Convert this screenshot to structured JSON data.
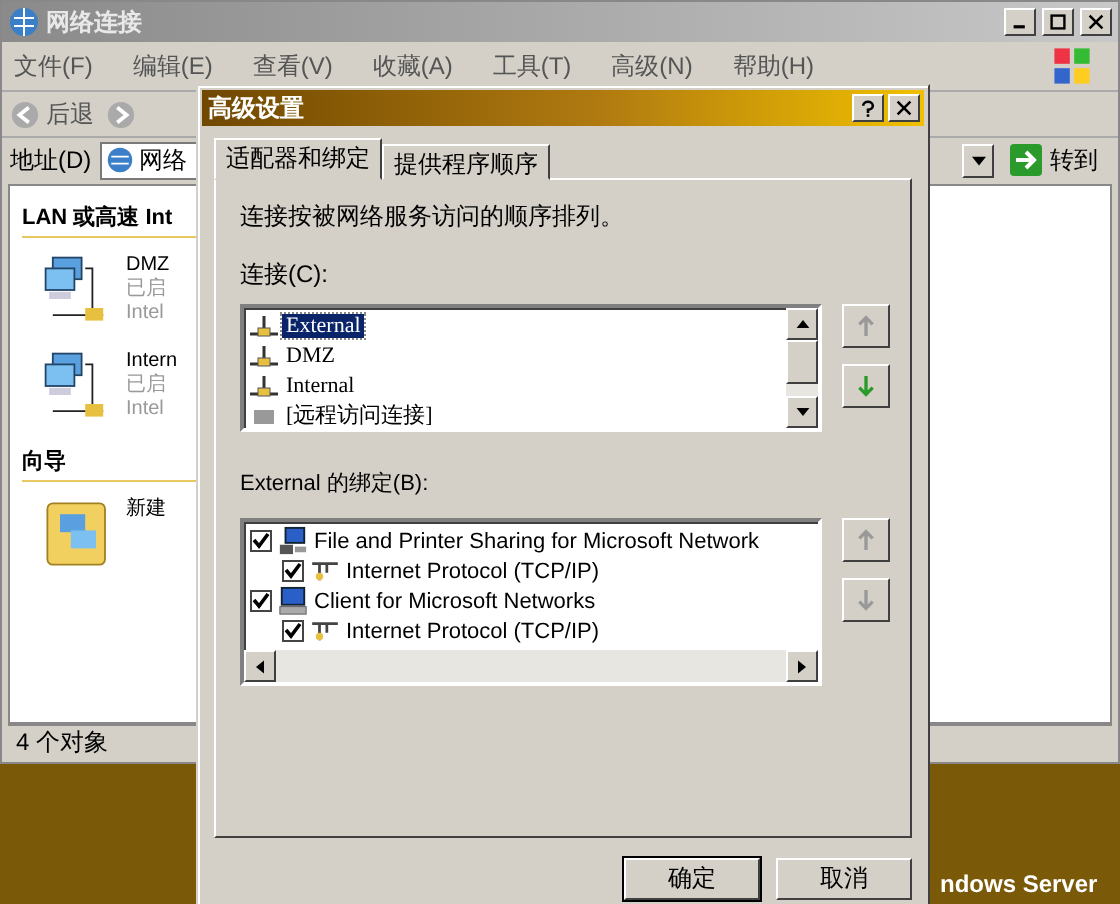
{
  "explorer": {
    "title": "网络连接",
    "menu": [
      "文件(F)",
      "编辑(E)",
      "查看(V)",
      "收藏(A)",
      "工具(T)",
      "高级(N)",
      "帮助(H)"
    ],
    "back_button": "后退",
    "address": {
      "label": "地址(D)",
      "value": "网络"
    },
    "go_button": "转到",
    "groups": [
      {
        "heading": "LAN 或高速 Int",
        "items": [
          {
            "kind": "adapter",
            "name": "DMZ",
            "status": "已启",
            "device": "Intel"
          },
          {
            "kind": "adapter",
            "name": "Intern",
            "status": "已启",
            "device": "Intel"
          }
        ]
      },
      {
        "heading": "向导",
        "items": [
          {
            "kind": "wizard",
            "name": "新建"
          }
        ]
      }
    ],
    "status_bar": "4 个对象"
  },
  "desktop_text": "ndows Server",
  "dialog": {
    "title": "高级设置",
    "tabs": [
      {
        "label": "适配器和绑定",
        "selected": true
      },
      {
        "label": "提供程序顺序",
        "selected": false
      }
    ],
    "description": "连接按被网络服务访问的顺序排列。",
    "connections_label": "连接(C):",
    "connections": [
      {
        "kind": "adapter",
        "label": "External",
        "selected": true
      },
      {
        "kind": "adapter",
        "label": "DMZ",
        "selected": false
      },
      {
        "kind": "adapter",
        "label": "Internal",
        "selected": false
      },
      {
        "kind": "remote",
        "label": "[远程访问连接]",
        "selected": false
      }
    ],
    "bindings_label": "External 的绑定(B):",
    "bindings": [
      {
        "kind": "service",
        "label": "File and Printer Sharing for Microsoft Network",
        "checked": true,
        "children": [
          {
            "label": "Internet Protocol (TCP/IP)",
            "checked": true
          }
        ]
      },
      {
        "kind": "client",
        "label": "Client for Microsoft Networks",
        "checked": true,
        "children": [
          {
            "label": "Internet Protocol (TCP/IP)",
            "checked": true
          }
        ]
      }
    ],
    "buttons": [
      {
        "label": "确定",
        "default": true
      },
      {
        "label": "取消",
        "default": false
      }
    ]
  }
}
